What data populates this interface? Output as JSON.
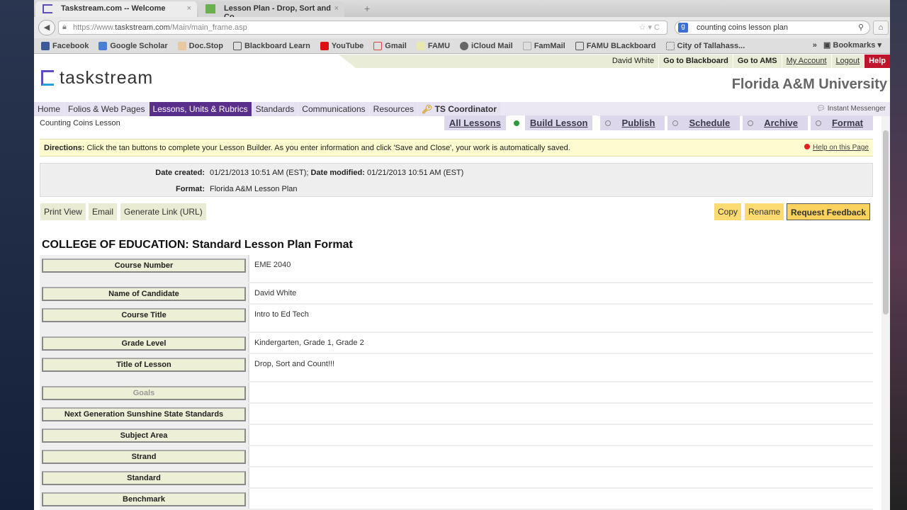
{
  "browser": {
    "tabs": [
      {
        "title": "Taskstream.com -- Welcome"
      },
      {
        "title": "Lesson Plan - Drop, Sort and Co..."
      }
    ],
    "url_prefix": "https://www.",
    "url_domain": "taskstream.com",
    "url_path": "/Main/main_frame.asp",
    "search_value": "counting coins lesson plan",
    "bookmarks": [
      "Facebook",
      "Google Scholar",
      "Doc.Stop",
      "Blackboard Learn",
      "YouTube",
      "Gmail",
      "FAMU",
      "iCloud Mail",
      "FamMail",
      "FAMU BLackboard",
      "City of Tallahass..."
    ],
    "bookmarks_menu": "Bookmarks"
  },
  "userbar": {
    "name": "David White",
    "blackboard": "Go to Blackboard",
    "ams": "Go to AMS",
    "account": "My Account",
    "logout": "Logout",
    "help": "Help"
  },
  "logo": "taskstream",
  "university": "Florida A&M University",
  "nav": [
    "Home",
    "Folios & Web Pages",
    "Lessons, Units & Rubrics",
    "Standards",
    "Communications",
    "Resources",
    "TS Coordinator"
  ],
  "instant_messenger": "Instant Messenger",
  "breadcrumb": "Counting Coins Lesson",
  "subtabs": [
    "All Lessons",
    "Build Lesson",
    "Publish",
    "Schedule",
    "Archive",
    "Format"
  ],
  "directions": {
    "label": "Directions:",
    "text": " Click the tan buttons to complete your Lesson Builder. As you enter information and click 'Save and Close', your work is automatically saved.",
    "help": "Help on this Page"
  },
  "meta": {
    "created_label": "Date created:",
    "created": "01/21/2013 10:51 AM (EST);",
    "modified_label": "Date modified:",
    "modified": "01/21/2013 10:51 AM (EST)",
    "format_label": "Format:",
    "format": "Florida A&M Lesson Plan"
  },
  "actions": {
    "print": "Print View",
    "email": "Email",
    "link": "Generate Link (URL)",
    "copy": "Copy",
    "rename": "Rename",
    "feedback": "Request Feedback"
  },
  "section_title": "COLLEGE OF EDUCATION: Standard Lesson Plan Format",
  "fields": [
    {
      "label": "Course Number",
      "value": "EME 2040"
    },
    {
      "label": "Name of Candidate",
      "value": "David White"
    },
    {
      "label": "Course Title",
      "value": "Intro to Ed Tech"
    },
    {
      "label": "Grade Level",
      "value": "Kindergarten, Grade 1, Grade 2"
    },
    {
      "label": "Title of Lesson",
      "value": "Drop, Sort and Count!!!"
    },
    {
      "label": "Goals",
      "value": ""
    },
    {
      "label": "Next Generation Sunshine State Standards",
      "value": ""
    },
    {
      "label": "Subject Area",
      "value": ""
    },
    {
      "label": "Strand",
      "value": ""
    },
    {
      "label": "Standard",
      "value": ""
    },
    {
      "label": "Benchmark",
      "value": ""
    }
  ]
}
